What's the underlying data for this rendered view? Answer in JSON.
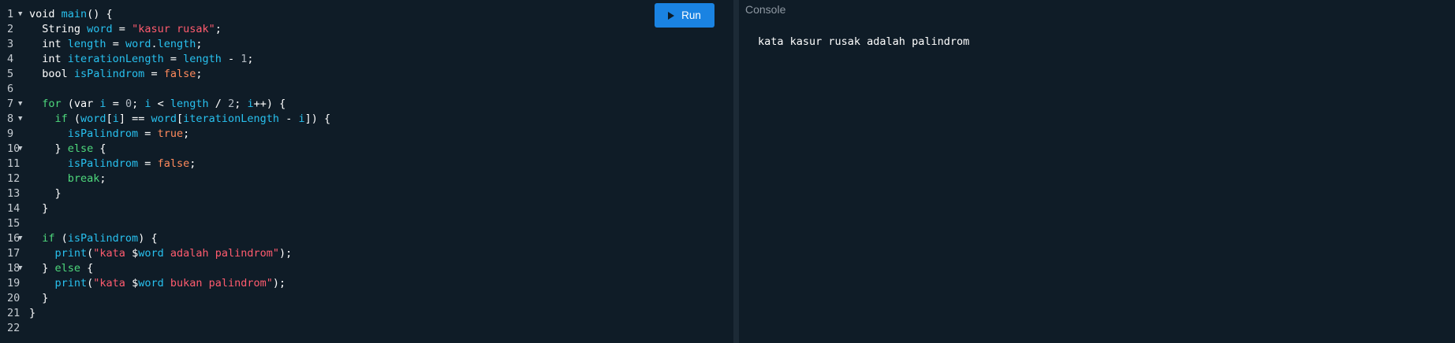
{
  "editor": {
    "lines": [
      {
        "n": "1",
        "fold": true,
        "tokens": [
          [
            "kw",
            "void "
          ],
          [
            "fn",
            "main"
          ],
          [
            "pl",
            "() {"
          ]
        ]
      },
      {
        "n": "2",
        "fold": false,
        "tokens": [
          [
            "kw",
            "  String "
          ],
          [
            "id",
            "word"
          ],
          [
            "pl",
            " = "
          ],
          [
            "str",
            "\"kasur rusak\""
          ],
          [
            "pl",
            ";"
          ]
        ]
      },
      {
        "n": "3",
        "fold": false,
        "tokens": [
          [
            "kw",
            "  int "
          ],
          [
            "id",
            "length"
          ],
          [
            "pl",
            " = "
          ],
          [
            "id",
            "word"
          ],
          [
            "pl",
            "."
          ],
          [
            "id",
            "length"
          ],
          [
            "pl",
            ";"
          ]
        ]
      },
      {
        "n": "4",
        "fold": false,
        "tokens": [
          [
            "kw",
            "  int "
          ],
          [
            "id",
            "iterationLength"
          ],
          [
            "pl",
            " = "
          ],
          [
            "id",
            "length"
          ],
          [
            "pl",
            " - "
          ],
          [
            "num",
            "1"
          ],
          [
            "pl",
            ";"
          ]
        ]
      },
      {
        "n": "5",
        "fold": false,
        "tokens": [
          [
            "kw",
            "  bool "
          ],
          [
            "id",
            "isPalindrom"
          ],
          [
            "pl",
            " = "
          ],
          [
            "bool",
            "false"
          ],
          [
            "pl",
            ";"
          ]
        ]
      },
      {
        "n": "6",
        "fold": false,
        "tokens": []
      },
      {
        "n": "7",
        "fold": true,
        "tokens": [
          [
            "flow",
            "  for "
          ],
          [
            "pl",
            "(var "
          ],
          [
            "id",
            "i"
          ],
          [
            "pl",
            " = "
          ],
          [
            "num",
            "0"
          ],
          [
            "pl",
            "; "
          ],
          [
            "id",
            "i"
          ],
          [
            "pl",
            " < "
          ],
          [
            "id",
            "length"
          ],
          [
            "pl",
            " / "
          ],
          [
            "num",
            "2"
          ],
          [
            "pl",
            "; "
          ],
          [
            "id",
            "i"
          ],
          [
            "pl",
            "++) {"
          ]
        ]
      },
      {
        "n": "8",
        "fold": true,
        "tokens": [
          [
            "flow",
            "    if "
          ],
          [
            "pl",
            "("
          ],
          [
            "id",
            "word"
          ],
          [
            "pl",
            "["
          ],
          [
            "id",
            "i"
          ],
          [
            "pl",
            "] == "
          ],
          [
            "id",
            "word"
          ],
          [
            "pl",
            "["
          ],
          [
            "id",
            "iterationLength"
          ],
          [
            "pl",
            " - "
          ],
          [
            "id",
            "i"
          ],
          [
            "pl",
            "]) {"
          ]
        ]
      },
      {
        "n": "9",
        "fold": false,
        "tokens": [
          [
            "id",
            "      isPalindrom"
          ],
          [
            "pl",
            " = "
          ],
          [
            "bool",
            "true"
          ],
          [
            "pl",
            ";"
          ]
        ]
      },
      {
        "n": "10",
        "fold": true,
        "tokens": [
          [
            "pl",
            "    } "
          ],
          [
            "flow",
            "else"
          ],
          [
            "pl",
            " {"
          ]
        ]
      },
      {
        "n": "11",
        "fold": false,
        "tokens": [
          [
            "id",
            "      isPalindrom"
          ],
          [
            "pl",
            " = "
          ],
          [
            "bool",
            "false"
          ],
          [
            "pl",
            ";"
          ]
        ]
      },
      {
        "n": "12",
        "fold": false,
        "tokens": [
          [
            "flow",
            "      break"
          ],
          [
            "pl",
            ";"
          ]
        ]
      },
      {
        "n": "13",
        "fold": false,
        "tokens": [
          [
            "pl",
            "    }"
          ]
        ]
      },
      {
        "n": "14",
        "fold": false,
        "tokens": [
          [
            "pl",
            "  }"
          ]
        ]
      },
      {
        "n": "15",
        "fold": false,
        "tokens": []
      },
      {
        "n": "16",
        "fold": true,
        "tokens": [
          [
            "flow",
            "  if "
          ],
          [
            "pl",
            "("
          ],
          [
            "id",
            "isPalindrom"
          ],
          [
            "pl",
            ") {"
          ]
        ]
      },
      {
        "n": "17",
        "fold": false,
        "tokens": [
          [
            "fn",
            "    print"
          ],
          [
            "pl",
            "("
          ],
          [
            "str",
            "\"kata "
          ],
          [
            "pl",
            "$"
          ],
          [
            "id",
            "word"
          ],
          [
            "str",
            " adalah palindrom\""
          ],
          [
            "pl",
            ");"
          ]
        ]
      },
      {
        "n": "18",
        "fold": true,
        "tokens": [
          [
            "pl",
            "  } "
          ],
          [
            "flow",
            "else"
          ],
          [
            "pl",
            " {"
          ]
        ]
      },
      {
        "n": "19",
        "fold": false,
        "tokens": [
          [
            "fn",
            "    print"
          ],
          [
            "pl",
            "("
          ],
          [
            "str",
            "\"kata "
          ],
          [
            "pl",
            "$"
          ],
          [
            "id",
            "word"
          ],
          [
            "str",
            " bukan palindrom\""
          ],
          [
            "pl",
            ");"
          ]
        ]
      },
      {
        "n": "20",
        "fold": false,
        "tokens": [
          [
            "pl",
            "  }"
          ]
        ]
      },
      {
        "n": "21",
        "fold": false,
        "tokens": [
          [
            "pl",
            "}"
          ]
        ]
      },
      {
        "n": "22",
        "fold": false,
        "tokens": []
      }
    ]
  },
  "toolbar": {
    "run_label": "Run",
    "run_icon": "play-icon"
  },
  "console": {
    "label": "Console",
    "output": "kata kasur rusak adalah palindrom"
  },
  "colors": {
    "background": "#0f1c27",
    "run_button": "#1a83e2",
    "keyword_flow": "#4ed87c",
    "identifier": "#28c0ee",
    "string": "#ff5b6e",
    "boolean": "#ff8a5c"
  }
}
